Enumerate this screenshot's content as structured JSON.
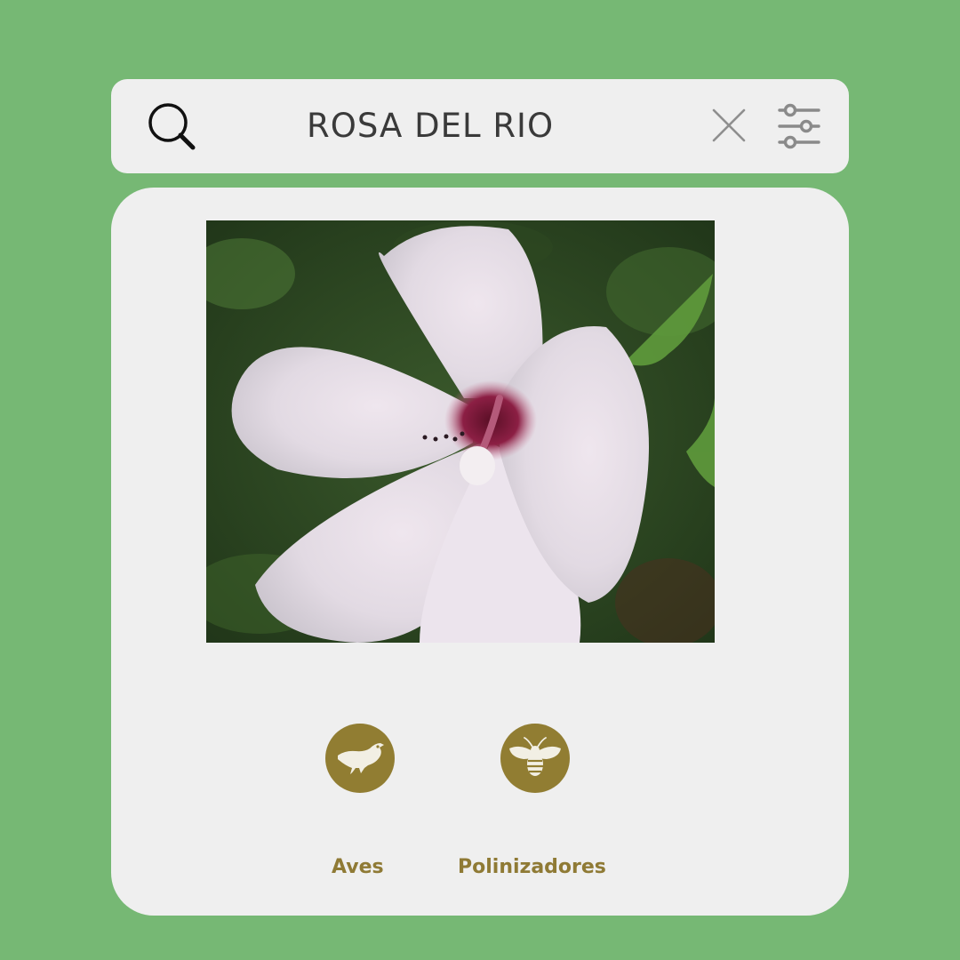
{
  "search": {
    "query": "ROSA DEL RIO",
    "icons": {
      "search": "search-icon",
      "clear": "close-icon",
      "filters": "sliders-icon"
    }
  },
  "result": {
    "image_icon": "hibiscus-flower-photo",
    "categories": [
      {
        "label": "Aves",
        "icon": "bird-icon"
      },
      {
        "label": "Polinizadores",
        "icon": "bee-icon"
      }
    ]
  },
  "colors": {
    "background": "#76b874",
    "panel": "#efefef",
    "accent": "#917d32",
    "accent_text": "#8f7a35",
    "query_text": "#3a3a3a"
  }
}
